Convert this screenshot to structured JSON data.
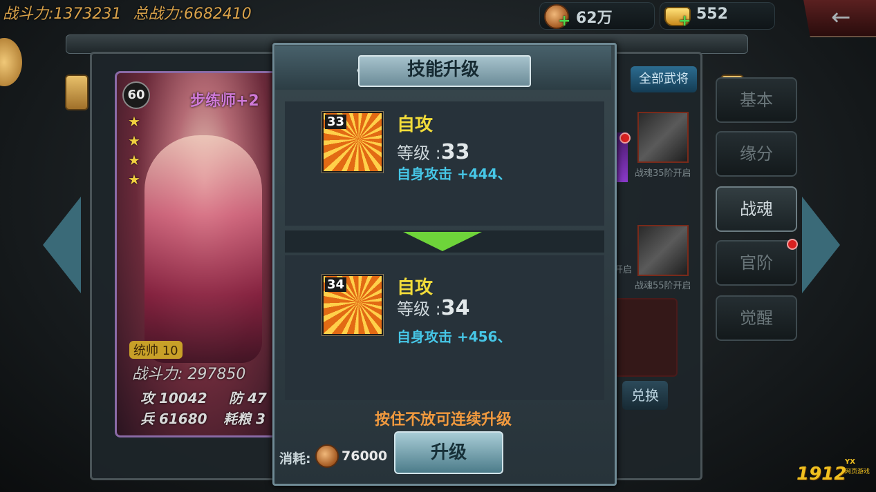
{
  "top_bar": {
    "battle_power": "战斗力:1373231",
    "total_power": "总战力:6682410",
    "copper": "62万",
    "gold": "552"
  },
  "hero_card": {
    "level": "60",
    "name": "步练师+2",
    "stars": 4,
    "command_badge": "统帅 10",
    "power": "战斗力: 297850",
    "stats": {
      "attack": "攻 10042",
      "defense": "防 47",
      "troops": "兵 61680",
      "food": "耗粮 3"
    }
  },
  "side_tabs": [
    "基本",
    "缘分",
    "战魂",
    "官阶",
    "觉醒"
  ],
  "side_active": "战魂",
  "right_panel": {
    "all_generals_btn": "全部武将",
    "slot_labels": [
      "战魂35阶开启",
      "战魂55阶开启",
      "开启"
    ],
    "exchange_btn": "兑换"
  },
  "dialog": {
    "title": "技能升级",
    "current": {
      "icon_level": "33",
      "name": "自攻",
      "level_label": "等级 :",
      "level": "33",
      "effect": "自身攻击 +444、"
    },
    "next": {
      "icon_level": "34",
      "name": "自攻",
      "level_label": "等级 :",
      "level": "34",
      "effect": "自身攻击 +456、"
    },
    "hint": "按住不放可连续升级",
    "cost_label": "消耗:",
    "cost_value": "76000",
    "upgrade_btn": "升级"
  },
  "watermark": {
    "brand": "1912",
    "tag": "YX",
    "sub": "网页游戏"
  }
}
